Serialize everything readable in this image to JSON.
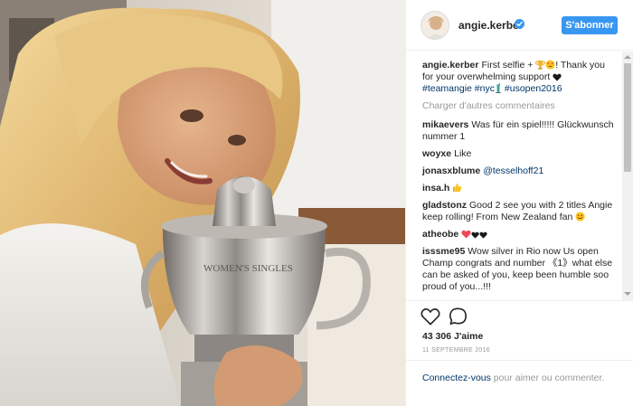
{
  "post": {
    "username": "angie.kerber",
    "follow_label": "S'abonner"
  },
  "caption": {
    "user": "angie.kerber",
    "text_start": "First selfie +",
    "text_end": "! Thank you for your overwhelming support",
    "hashtags": [
      "#teamangie",
      "#nyc",
      "#usopen2016"
    ]
  },
  "load_more": "Charger d'autres commentaires",
  "comments": [
    {
      "user": "mikaevers",
      "text": "Was für ein spiel!!!!! Glückwunsch nummer 1"
    },
    {
      "user": "woyxe",
      "text": "Like"
    },
    {
      "user": "jonasxblume",
      "text": "@tesselhoff21"
    },
    {
      "user": "insa.h",
      "text": ""
    },
    {
      "user": "gladstonz",
      "text": "Good 2 see you with 2 titles Angie keep rolling! From New Zealand fan"
    },
    {
      "user": "atheobe",
      "text": ""
    },
    {
      "user": "isssme95",
      "text": "Wow silver in Rio now Us open Champ congrats and number 《1》what else can be asked of you, keep been humble soo proud of you...!!!"
    }
  ],
  "actions": {
    "likes": "43 306 J'aime",
    "date": "11 SEPTEMBRE 2016"
  },
  "login": {
    "link": "Connectez-vous",
    "rest": " pour aimer ou commenter."
  },
  "colors": {
    "accent": "#3897f0",
    "link": "#003569",
    "muted": "#999999",
    "heart": "#ed4956"
  },
  "icons": [
    "verified-badge-icon",
    "heart-outline-icon",
    "comment-icon",
    "trophy-emoji",
    "heart-eyes-emoji",
    "black-heart-emoji",
    "thumbs-up-emoji",
    "smile-emoji",
    "red-heart-emoji",
    "statue-of-liberty-emoji"
  ]
}
